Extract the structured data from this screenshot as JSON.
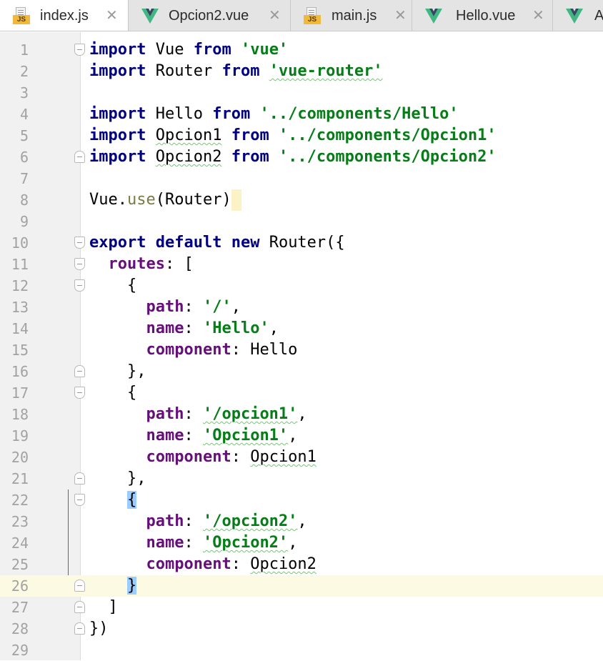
{
  "tabs": [
    {
      "label": "index.js",
      "icon": "js-file-icon",
      "active": true
    },
    {
      "label": "Opcion2.vue",
      "icon": "vue-file-icon",
      "active": false
    },
    {
      "label": "main.js",
      "icon": "js-file-icon",
      "active": false
    },
    {
      "label": "Hello.vue",
      "icon": "vue-file-icon",
      "active": false
    },
    {
      "label": "A",
      "icon": "vue-file-icon",
      "active": false
    }
  ],
  "tab_close_symbol": "✕",
  "js_badge": "JS",
  "colors": {
    "keyword": "#000080",
    "string": "#067d17",
    "property": "#660e7a",
    "function": "#7a7a43",
    "vue_green": "#41b883",
    "vue_dark": "#35495e",
    "current_line": "#fdfae4"
  },
  "editor": {
    "current_line": 26,
    "line_numbers": [
      "1",
      "2",
      "3",
      "4",
      "5",
      "6",
      "7",
      "8",
      "9",
      "10",
      "11",
      "12",
      "13",
      "14",
      "15",
      "16",
      "17",
      "18",
      "19",
      "20",
      "21",
      "22",
      "23",
      "24",
      "25",
      "26",
      "27",
      "28",
      "29"
    ],
    "lines": [
      [
        {
          "t": "import",
          "c": "kw"
        },
        {
          "t": " Vue "
        },
        {
          "t": "from",
          "c": "kw"
        },
        {
          "t": " "
        },
        {
          "t": "'vue'",
          "c": "str"
        }
      ],
      [
        {
          "t": "import",
          "c": "kw"
        },
        {
          "t": " Router "
        },
        {
          "t": "from",
          "c": "kw"
        },
        {
          "t": " "
        },
        {
          "t": "'vue-router'",
          "c": "str typo"
        }
      ],
      [],
      [
        {
          "t": "import",
          "c": "kw"
        },
        {
          "t": " Hello "
        },
        {
          "t": "from",
          "c": "kw"
        },
        {
          "t": " "
        },
        {
          "t": "'../components/Hello'",
          "c": "str"
        }
      ],
      [
        {
          "t": "import",
          "c": "kw"
        },
        {
          "t": " "
        },
        {
          "t": "Opcion1",
          "c": "typo"
        },
        {
          "t": " "
        },
        {
          "t": "from",
          "c": "kw"
        },
        {
          "t": " "
        },
        {
          "t": "'../components/Opcion1'",
          "c": "str"
        }
      ],
      [
        {
          "t": "import",
          "c": "kw"
        },
        {
          "t": " "
        },
        {
          "t": "Opcion2",
          "c": "typo"
        },
        {
          "t": " "
        },
        {
          "t": "from",
          "c": "kw"
        },
        {
          "t": " "
        },
        {
          "t": "'../components/Opcion2'",
          "c": "str"
        }
      ],
      [],
      [
        {
          "t": "Vue."
        },
        {
          "t": "use",
          "c": "fn"
        },
        {
          "t": "(Router)"
        },
        {
          "t": "",
          "c": "caretbox"
        }
      ],
      [],
      [
        {
          "t": "export",
          "c": "kw"
        },
        {
          "t": " "
        },
        {
          "t": "default",
          "c": "kw"
        },
        {
          "t": " "
        },
        {
          "t": "new",
          "c": "kw"
        },
        {
          "t": " Router({"
        }
      ],
      [
        {
          "t": "  "
        },
        {
          "t": "routes",
          "c": "prop"
        },
        {
          "t": ": ["
        }
      ],
      [
        {
          "t": "    {"
        }
      ],
      [
        {
          "t": "      "
        },
        {
          "t": "path",
          "c": "prop"
        },
        {
          "t": ": "
        },
        {
          "t": "'/'",
          "c": "str"
        },
        {
          "t": ","
        }
      ],
      [
        {
          "t": "      "
        },
        {
          "t": "name",
          "c": "prop"
        },
        {
          "t": ": "
        },
        {
          "t": "'Hello'",
          "c": "str"
        },
        {
          "t": ","
        }
      ],
      [
        {
          "t": "      "
        },
        {
          "t": "component",
          "c": "prop"
        },
        {
          "t": ": Hello"
        }
      ],
      [
        {
          "t": "    },"
        }
      ],
      [
        {
          "t": "    {"
        }
      ],
      [
        {
          "t": "      "
        },
        {
          "t": "path",
          "c": "prop"
        },
        {
          "t": ": "
        },
        {
          "t": "'/opcion1'",
          "c": "str typo"
        },
        {
          "t": ","
        }
      ],
      [
        {
          "t": "      "
        },
        {
          "t": "name",
          "c": "prop"
        },
        {
          "t": ": "
        },
        {
          "t": "'Opcion1'",
          "c": "str typo"
        },
        {
          "t": ","
        }
      ],
      [
        {
          "t": "      "
        },
        {
          "t": "component",
          "c": "prop"
        },
        {
          "t": ": "
        },
        {
          "t": "Opcion1",
          "c": "typo"
        }
      ],
      [
        {
          "t": "    },"
        }
      ],
      [
        {
          "t": "    "
        },
        {
          "t": "{",
          "c": "bracehl"
        }
      ],
      [
        {
          "t": "      "
        },
        {
          "t": "path",
          "c": "prop"
        },
        {
          "t": ": "
        },
        {
          "t": "'/opcion2'",
          "c": "str typo"
        },
        {
          "t": ","
        }
      ],
      [
        {
          "t": "      "
        },
        {
          "t": "name",
          "c": "prop"
        },
        {
          "t": ": "
        },
        {
          "t": "'Opcion2'",
          "c": "str typo"
        },
        {
          "t": ","
        }
      ],
      [
        {
          "t": "      "
        },
        {
          "t": "component",
          "c": "prop"
        },
        {
          "t": ": "
        },
        {
          "t": "Opcion2",
          "c": "typo"
        }
      ],
      [
        {
          "t": "    "
        },
        {
          "t": "}",
          "c": "bracehl"
        }
      ],
      [
        {
          "t": "  ]"
        }
      ],
      [
        {
          "t": "})"
        }
      ],
      []
    ],
    "fold_markers": {
      "1": "open",
      "6": "close",
      "10": "open",
      "11": "open",
      "12": "open",
      "16": "close",
      "17": "open",
      "21": "close",
      "22": "open",
      "26": "close",
      "27": "close",
      "28": "close"
    }
  }
}
